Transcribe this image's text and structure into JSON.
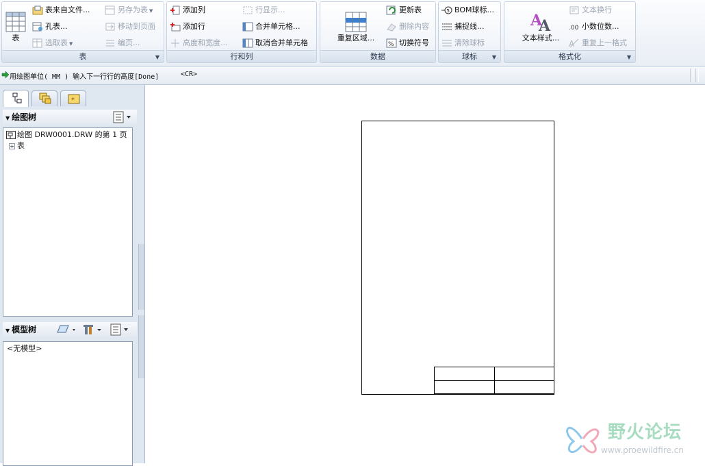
{
  "ribbon": {
    "groups": {
      "table": {
        "label": "表",
        "big_label": "表",
        "items": [
          "表来自文件...",
          "孔表...",
          "选取表",
          "另存为表",
          "移动到页面",
          "编页..."
        ]
      },
      "rowcol": {
        "label": "行和列",
        "items": [
          "添加列",
          "添加行",
          "高度和宽度...",
          "行显示...",
          "合并单元格...",
          "取消合并单元格"
        ]
      },
      "data": {
        "label": "数据",
        "big_label": "重复区域...",
        "items": [
          "更新表",
          "删除内容",
          "切换符号"
        ]
      },
      "balloon": {
        "label": "球标",
        "items": [
          "BOM球标...",
          "捕捉线...",
          "清除球标"
        ]
      },
      "format": {
        "label": "格式化",
        "big_label": "文本样式...",
        "items": [
          "文本换行",
          "小数位数...",
          "重复上一格式"
        ]
      }
    }
  },
  "message": {
    "text": "用绘图单位( MM ) 输入下一行行的高度[Done]",
    "cr": "<CR>"
  },
  "nav": {
    "drawing_tree": {
      "title": "绘图树",
      "root": "绘图 DRW0001.DRW 的第 1 页",
      "child": "表"
    },
    "model_tree": {
      "title": "模型树",
      "empty": "<无模型>"
    }
  },
  "watermark": {
    "title": "野火论坛",
    "url": "www.proewildfire.cn"
  },
  "colors": {
    "ribbon_border": "#c5d2e1",
    "nav_bg": "#dfe7f1",
    "accent_blue": "#2f6fc0",
    "watermark_green": "#a8dcc0"
  }
}
